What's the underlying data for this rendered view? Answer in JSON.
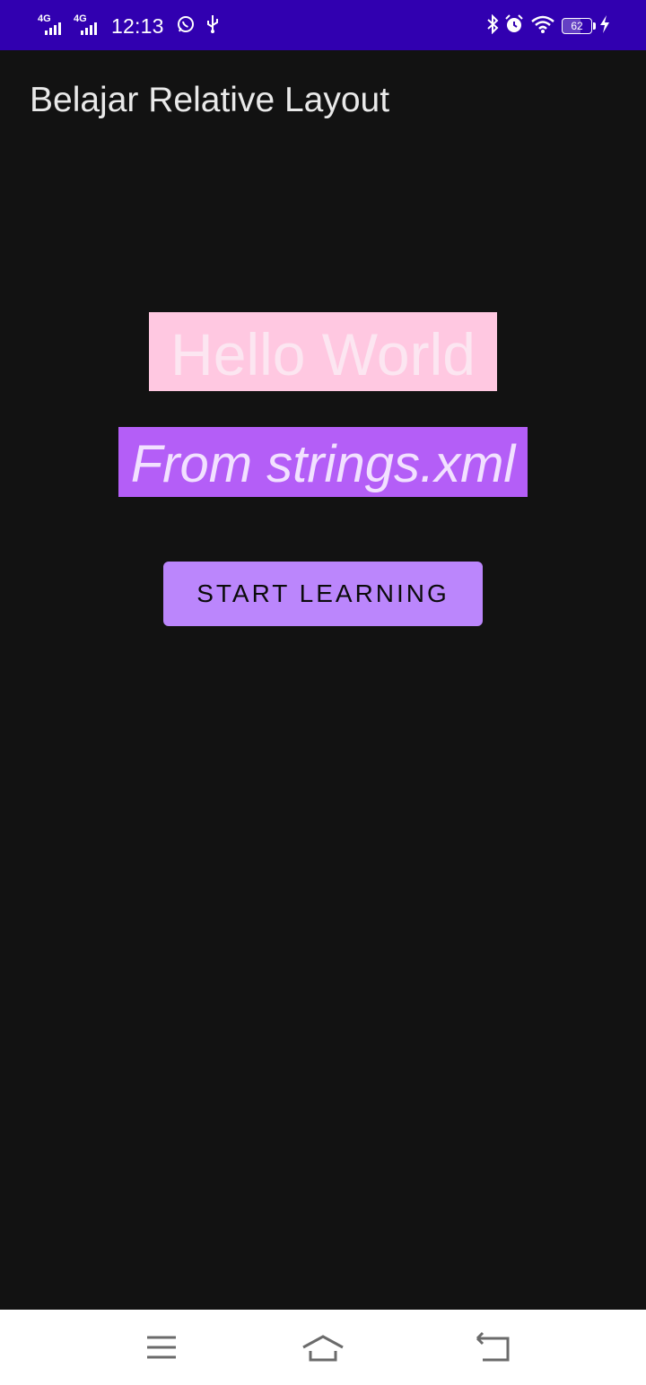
{
  "status_bar": {
    "network_1": "4G",
    "network_2": "4G",
    "time": "12:13",
    "battery_level": "62",
    "icons": [
      "signal-icon",
      "whatsapp-icon",
      "usb-icon",
      "bluetooth-icon",
      "alarm-icon",
      "wifi-icon",
      "battery-icon",
      "charging-icon"
    ],
    "background_color": "#3100b0"
  },
  "app_bar": {
    "title": "Belajar Relative Layout"
  },
  "content": {
    "hello_text": "Hello World",
    "hello_background": "#ffc8e1",
    "from_text": "From strings.xml",
    "from_background": "#b45ef7",
    "start_button_label": "START LEARNING",
    "button_color": "#bb86fc"
  },
  "nav_bar": {
    "icons": [
      "menu-icon",
      "home-icon",
      "back-icon"
    ]
  }
}
